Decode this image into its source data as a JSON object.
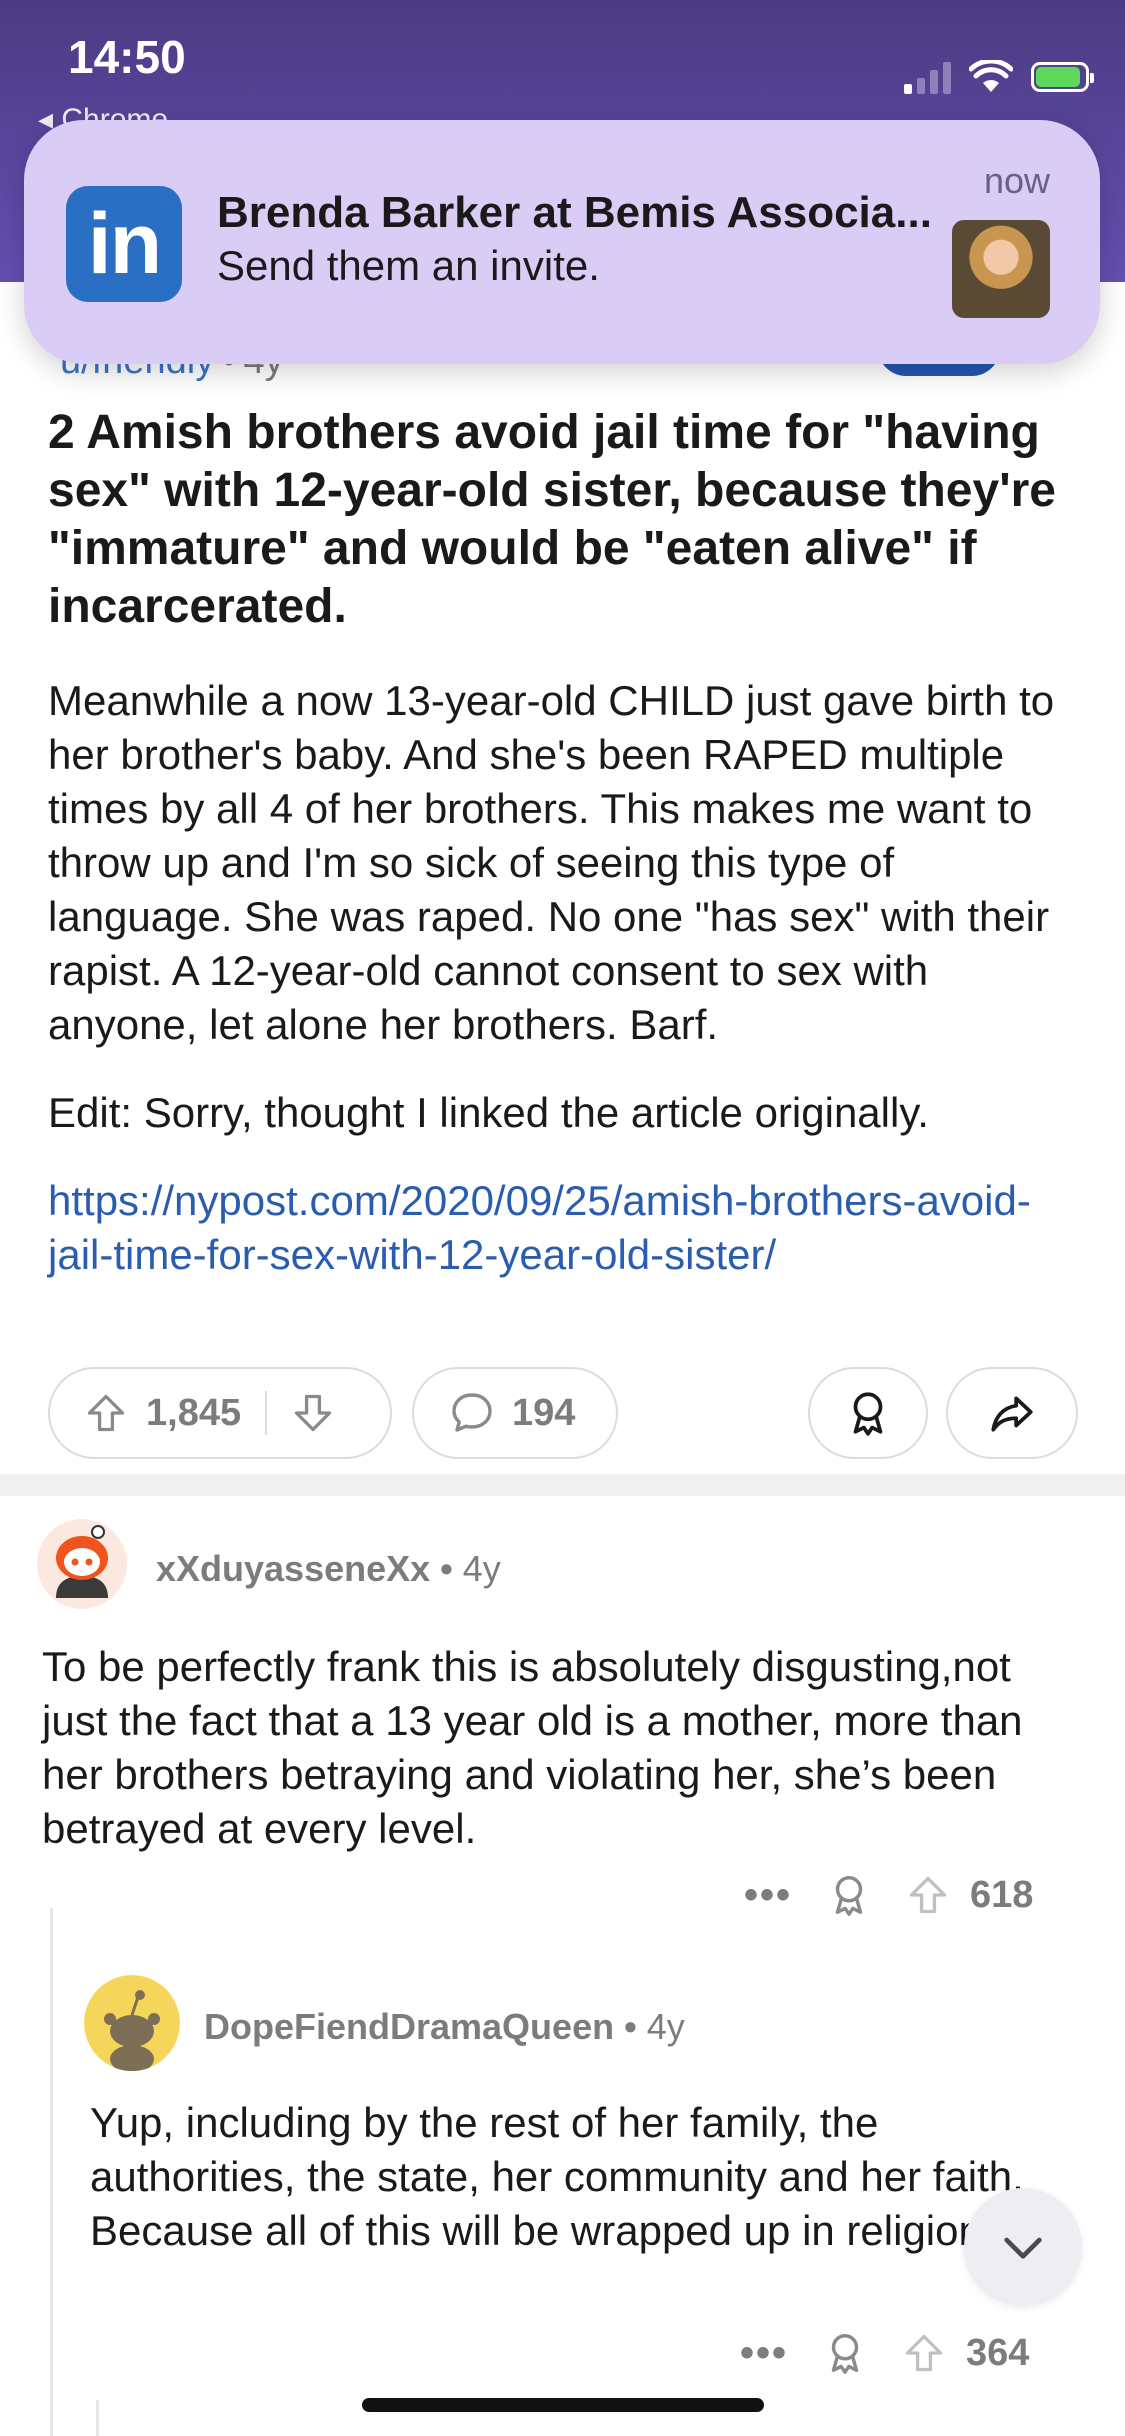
{
  "status_bar": {
    "time": "14:50",
    "back_app": "◂ Chrome"
  },
  "notification": {
    "app_logo_text": "in",
    "title": "Brenda Barker at Bemis Associa...",
    "body": "Send them an invite.",
    "time": "now"
  },
  "post": {
    "author": "u/friendly",
    "age": "4y",
    "title": "2 Amish brothers avoid jail time for \"having sex\" with 12-year-old sister, because they're \"immature\" and would be \"eaten alive\" if incarcerated.",
    "body_paragraph": "Meanwhile a now 13-year-old CHILD just gave birth to her brother's baby. And she's been RAPED multiple times by all 4 of her brothers. This makes me want to throw up and I'm so sick of seeing this type of language. She was raped. No one \"has sex\" with their rapist. A 12-year-old cannot consent to sex with anyone, let alone her brothers. Barf.",
    "edit_paragraph": "Edit: Sorry, thought I linked the article originally.",
    "link": "https://nypost.com/2020/09/25/amish-brothers-avoid-jail-time-for-sex-with-12-year-old-sister/",
    "upvotes": "1,845",
    "comments": "194"
  },
  "comments": [
    {
      "username": "xXduyasseneXx",
      "age": "4y",
      "text": "To be perfectly frank this is absolutely disgusting,not just the fact that a 13 year old is a mother, more than her brothers betraying and violating her, she’s been betrayed at every level.",
      "more": "•••",
      "score": "618"
    },
    {
      "username": "DopeFiendDramaQueen",
      "age": "4y",
      "text": "Yup, including by the rest of her family, the authorities, the state, her community and her faith. Because all of this will be wrapped up in religion.",
      "more": "•••",
      "score": "364"
    }
  ],
  "colors": {
    "header_purple": "#5a48a0",
    "notification_bg": "#d9cdf5",
    "linkedin_blue": "#2b6fc4",
    "link_blue": "#2a5db0",
    "meta_gray": "#7c7c7c"
  }
}
